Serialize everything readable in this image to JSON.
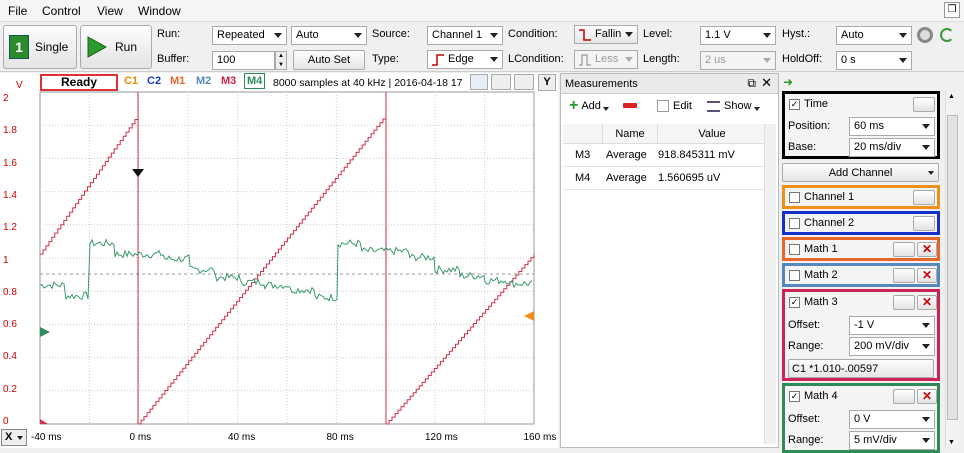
{
  "menu": [
    "File",
    "Control",
    "View",
    "Window"
  ],
  "toolbar": {
    "single": "Single",
    "run": "Run",
    "run_label": "Run:",
    "run_value": "Repeated",
    "run_mode": "Auto",
    "buffer_label": "Buffer:",
    "buffer_value": "100",
    "autoset": "Auto Set",
    "source_label": "Source:",
    "source_value": "Channel 1",
    "type_label": "Type:",
    "type_value": "Edge",
    "condition_label": "Condition:",
    "condition_value": "Fallin",
    "lcondition_label": "LCondition:",
    "lcondition_value": "Less",
    "level_label": "Level:",
    "level_value": "1.1 V",
    "length_label": "Length:",
    "length_value": "2 us",
    "hyst_label": "Hyst.:",
    "hyst_value": "Auto",
    "holdoff_label": "HoldOff:",
    "holdoff_value": "0 s"
  },
  "scope": {
    "status": "Ready",
    "tags": [
      {
        "t": "C1",
        "c": "#e68a00"
      },
      {
        "t": "C2",
        "c": "#1a3cc8"
      },
      {
        "t": "M1",
        "c": "#e8662a"
      },
      {
        "t": "M2",
        "c": "#5588bb"
      },
      {
        "t": "M3",
        "c": "#cc2244"
      },
      {
        "t": "M4",
        "c": "#2e8b57"
      }
    ],
    "info": "8000 samples at 40 kHz | 2016-04-18 17",
    "y_unit": "V",
    "y_ticks": [
      "2",
      "1.8",
      "1.6",
      "1.4",
      "1.2",
      "1",
      "0.8",
      "0.6",
      "0.4",
      "0.2",
      "0"
    ],
    "x_ticks": [
      "-40 ms",
      "0 ms",
      "40 ms",
      "80 ms",
      "120 ms",
      "160 ms"
    ],
    "x_button": "X",
    "y_button": "Y"
  },
  "measurements": {
    "title": "Measurements",
    "add": "Add",
    "edit": "Edit",
    "show": "Show",
    "headers": [
      "Name",
      "Value"
    ],
    "rows": [
      {
        "ch": "M3",
        "name": "Average",
        "value": "918.845311 mV"
      },
      {
        "ch": "M4",
        "name": "Average",
        "value": "1.560695 uV"
      }
    ]
  },
  "side": {
    "time": {
      "label": "Time",
      "position_label": "Position:",
      "position": "60 ms",
      "base_label": "Base:",
      "base": "20 ms/div"
    },
    "add_channel": "Add Channel",
    "channel1": "Channel 1",
    "channel2": "Channel 2",
    "math1": "Math 1",
    "math2": "Math 2",
    "math3": {
      "label": "Math 3",
      "offset_label": "Offset:",
      "offset": "-1 V",
      "range_label": "Range:",
      "range": "200 mV/div",
      "formula": "C1 *1.010-.00597"
    },
    "math4": {
      "label": "Math 4",
      "offset_label": "Offset:",
      "offset": "0 V",
      "range_label": "Range:",
      "range": "5 mV/div"
    }
  },
  "colors": {
    "time": "#000000",
    "channel1": "#f0901a",
    "channel2": "#1530c8",
    "math1": "#e8662a",
    "math2": "#5588bb",
    "math3": "#cc2255",
    "math4": "#2e8b57"
  }
}
